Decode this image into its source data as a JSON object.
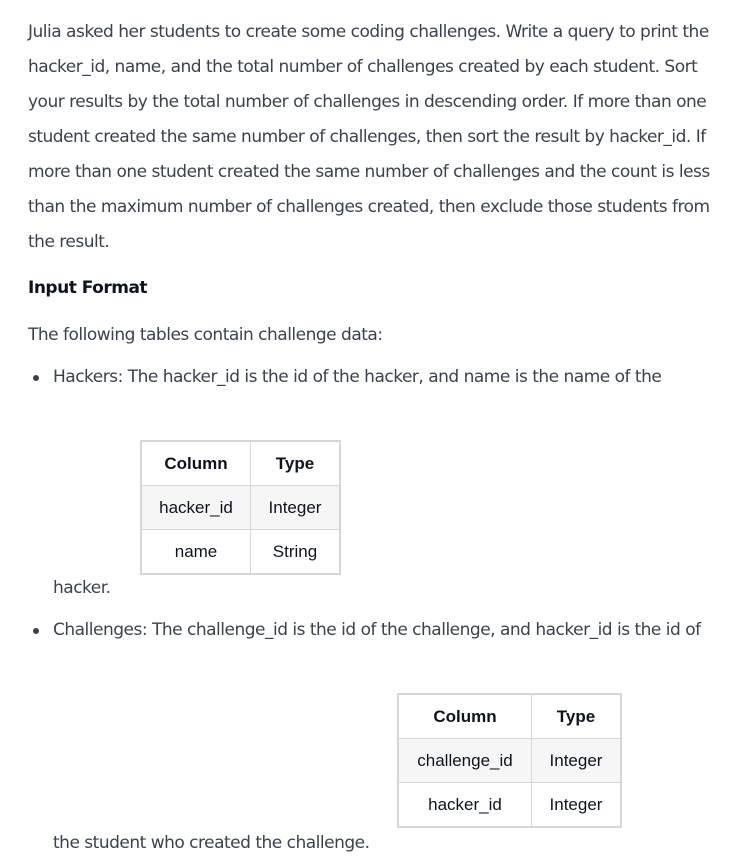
{
  "intro": "Julia asked her students to create some coding challenges. Write a query to print the hacker_id, name, and the total number of challenges created by each student. Sort your results by the total number of challenges in descending order. If more than one student created the same number of challenges, then sort the result by hacker_id. If more than one student created the same number of challenges and the count is less than the maximum number of challenges created, then exclude those students from the result.",
  "input_format_heading": "Input Format",
  "tables_intro": "The following tables contain challenge data:",
  "hackers": {
    "text_before": "Hackers: The hacker_id is the id of the hacker, and name is the name of the",
    "text_after": "hacker.",
    "table": {
      "headers": [
        "Column",
        "Type"
      ],
      "rows": [
        [
          "hacker_id",
          "Integer"
        ],
        [
          "name",
          "String"
        ]
      ]
    }
  },
  "challenges": {
    "text_before": "Challenges: The challenge_id is the id of the challenge, and hacker_id is the id of",
    "text_after": "the student who created the challenge.",
    "table": {
      "headers": [
        "Column",
        "Type"
      ],
      "rows": [
        [
          "challenge_id",
          "Integer"
        ],
        [
          "hacker_id",
          "Integer"
        ]
      ]
    }
  }
}
